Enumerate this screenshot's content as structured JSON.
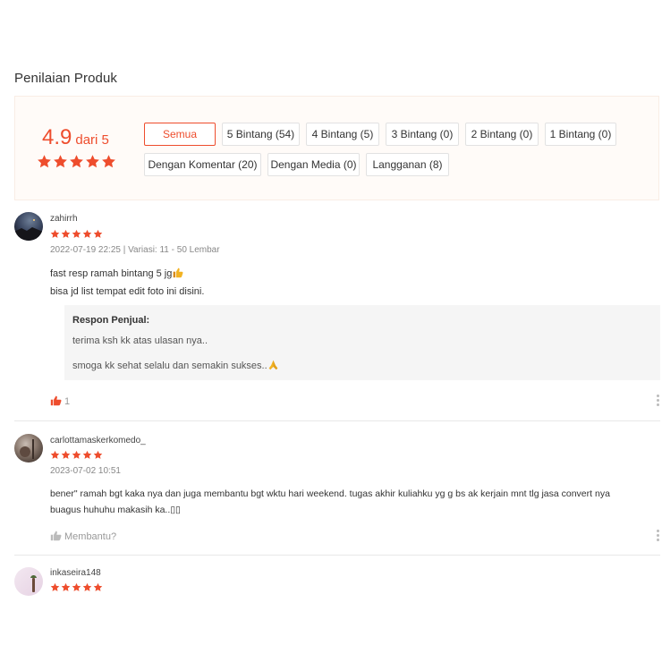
{
  "section_title": "Penilaian Produk",
  "accent_color": "#ee4d2d",
  "summary": {
    "score": "4.9",
    "out_of": "dari 5",
    "stars": 5
  },
  "filters": [
    {
      "label": "Semua",
      "active": true
    },
    {
      "label": "5 Bintang (54)",
      "active": false
    },
    {
      "label": "4 Bintang (5)",
      "active": false
    },
    {
      "label": "3 Bintang (0)",
      "active": false
    },
    {
      "label": "2 Bintang (0)",
      "active": false
    },
    {
      "label": "1 Bintang (0)",
      "active": false
    },
    {
      "label": "Dengan Komentar (20)",
      "active": false
    },
    {
      "label": "Dengan Media (0)",
      "active": false
    },
    {
      "label": "Langganan (8)",
      "active": false
    }
  ],
  "reviews": [
    {
      "username": "zahirrh",
      "stars": 5,
      "meta": "2022-07-19 22:25 | Variasi: 11 - 50 Lembar",
      "comment_lines": [
        "fast resp ramah bintang 5 jg",
        "bisa jd list tempat edit foto ini disini."
      ],
      "comment_emoji": "thumbs-up-icon",
      "seller_response": {
        "title": "Respon Penjual:",
        "lines": [
          "terima ksh kk atas ulasan nya..",
          "smoga kk sehat selalu dan semakin sukses.."
        ],
        "emoji": "praying-hands-icon"
      },
      "likes": "1",
      "liked": true
    },
    {
      "username": "carlottamaskerkomedo_",
      "stars": 5,
      "meta": "2023-07-02 10:51",
      "comment_lines": [
        "bener\" ramah bgt kaka nya dan juga membantu bgt wktu hari weekend. tugas akhir kuliahku yg g bs ak kerjain mnt tlg jasa convert nya",
        "buagus huhuhu makasih ka..▯▯"
      ],
      "helpful_label": "Membantu?",
      "liked": false
    },
    {
      "username": "inkaseira148",
      "stars": 5
    }
  ]
}
